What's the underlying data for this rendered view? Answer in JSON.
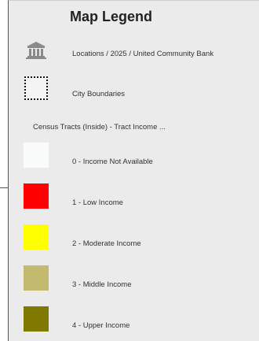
{
  "legend": {
    "title": "Map Legend",
    "layers": [
      {
        "label": "Locations / 2025 / United Community Bank",
        "icon": "bank-building-icon"
      },
      {
        "label": "City Boundaries",
        "icon": "dotted-boundary-icon"
      }
    ],
    "census_group": {
      "heading": "Census Tracts (Inside) - Tract Income ...",
      "classes": [
        {
          "label": "0 - Income Not Available",
          "color": "#fafcfc"
        },
        {
          "label": "1 - Low Income",
          "color": "#ff0000"
        },
        {
          "label": "2 - Moderate Income",
          "color": "#ffff00"
        },
        {
          "label": "3 - Middle Income",
          "color": "#c3b96f"
        },
        {
          "label": "4 - Upper Income",
          "color": "#807900"
        }
      ]
    }
  }
}
